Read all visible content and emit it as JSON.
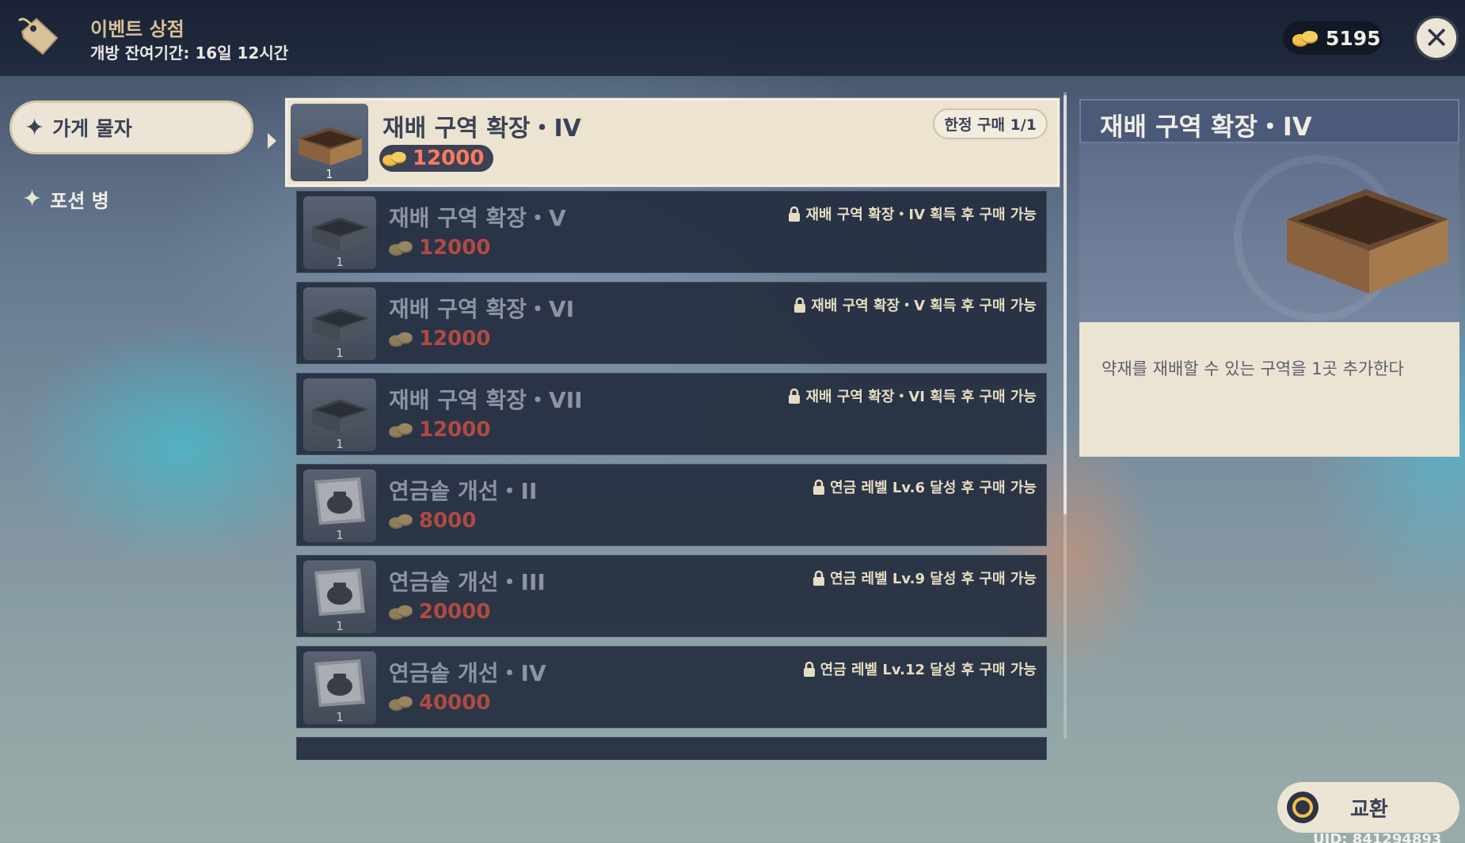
{
  "header": {
    "title": "이벤트 상점",
    "subtitle": "개방 잔여기간: 16일 12시간",
    "icon": "price-tag-icon"
  },
  "currency": {
    "icon": "mora-coin-icon",
    "amount": "5195"
  },
  "close": {
    "icon": "close-icon"
  },
  "categories": [
    {
      "label": "가게 물자",
      "icon": "four-point-star-icon",
      "selected": true
    },
    {
      "label": "포션 병",
      "icon": "four-point-star-icon",
      "selected": false
    }
  ],
  "items": [
    {
      "name": "재배 구역 확장・IV",
      "qty": "1",
      "price": "12000",
      "badge": "한정 구매 1/1",
      "thumb": "planter-box-icon",
      "active": true
    },
    {
      "name": "재배 구역 확장・V",
      "qty": "1",
      "price": "12000",
      "lock": "재배 구역 확장・IV 획득 후 구매 가능",
      "thumb": "planter-box-icon"
    },
    {
      "name": "재배 구역 확장・VI",
      "qty": "1",
      "price": "12000",
      "lock": "재배 구역 확장・V 획득 후 구매 가능",
      "thumb": "planter-box-icon"
    },
    {
      "name": "재배 구역 확장・VII",
      "qty": "1",
      "price": "12000",
      "lock": "재배 구역 확장・VI 획득 후 구매 가능",
      "thumb": "planter-box-icon"
    },
    {
      "name": "연금솥 개선・II",
      "qty": "1",
      "price": "8000",
      "lock": "연금 레벨 Lv.6 달성 후 구매 가능",
      "thumb": "cauldron-scroll-icon"
    },
    {
      "name": "연금솥 개선・III",
      "qty": "1",
      "price": "20000",
      "lock": "연금 레벨 Lv.9 달성 후 구매 가능",
      "thumb": "cauldron-scroll-icon"
    },
    {
      "name": "연금솥 개선・IV",
      "qty": "1",
      "price": "40000",
      "lock": "연금 레벨 Lv.12 달성 후 구매 가능",
      "thumb": "cauldron-scroll-icon"
    }
  ],
  "detail": {
    "title": "재배 구역 확장・IV",
    "description": "약재를 재배할 수 있는 구역을 1곳 추가한다",
    "art": "planter-box-icon"
  },
  "exchange": {
    "label": "교환",
    "icon": "confirm-circle-icon"
  },
  "uid": "UID: 841294893",
  "colors": {
    "accent": "#d7c194",
    "panel": "#ece4d3",
    "price_active": "#ff7a5c",
    "price_locked": "#b04a43"
  }
}
